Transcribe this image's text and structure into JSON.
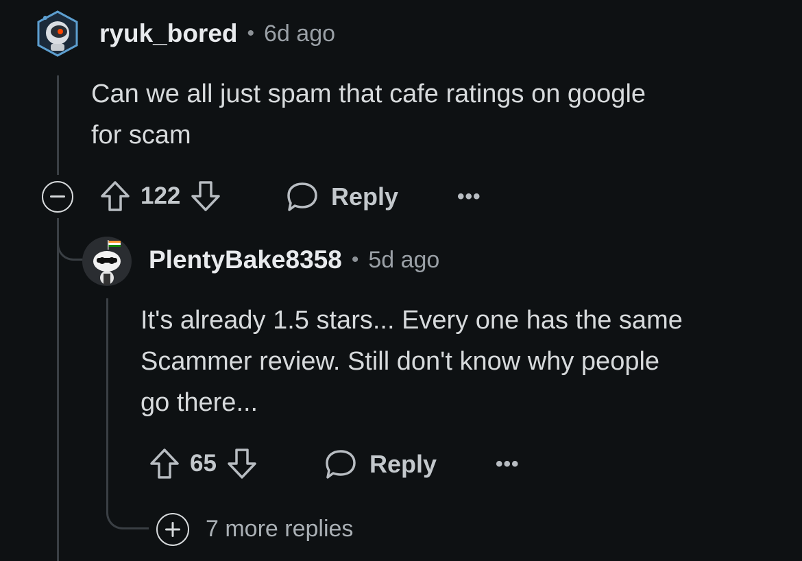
{
  "comment": {
    "username": "ryuk_bored",
    "separator": "•",
    "time": "6d ago",
    "body_line1": "Can we all just spam that cafe ratings on google",
    "body_line2": "for scam",
    "votes": "122",
    "reply_label": "Reply",
    "more_label": "•••",
    "collapse_icon": "minus-icon"
  },
  "reply": {
    "username": "PlentyBake8358",
    "separator": "•",
    "time": "5d ago",
    "body_line1": "It's already 1.5 stars... Every one has the same",
    "body_line2": "Scammer review. Still don't know why people",
    "body_line3": "go there...",
    "votes": "65",
    "reply_label": "Reply",
    "more_label": "•••"
  },
  "more_replies": {
    "label": "7 more replies",
    "expand_icon": "plus-icon"
  },
  "colors": {
    "background": "#0e1113",
    "text": "#d7dadc",
    "muted": "#9aa0a6",
    "thread_line": "#3a3f44"
  }
}
